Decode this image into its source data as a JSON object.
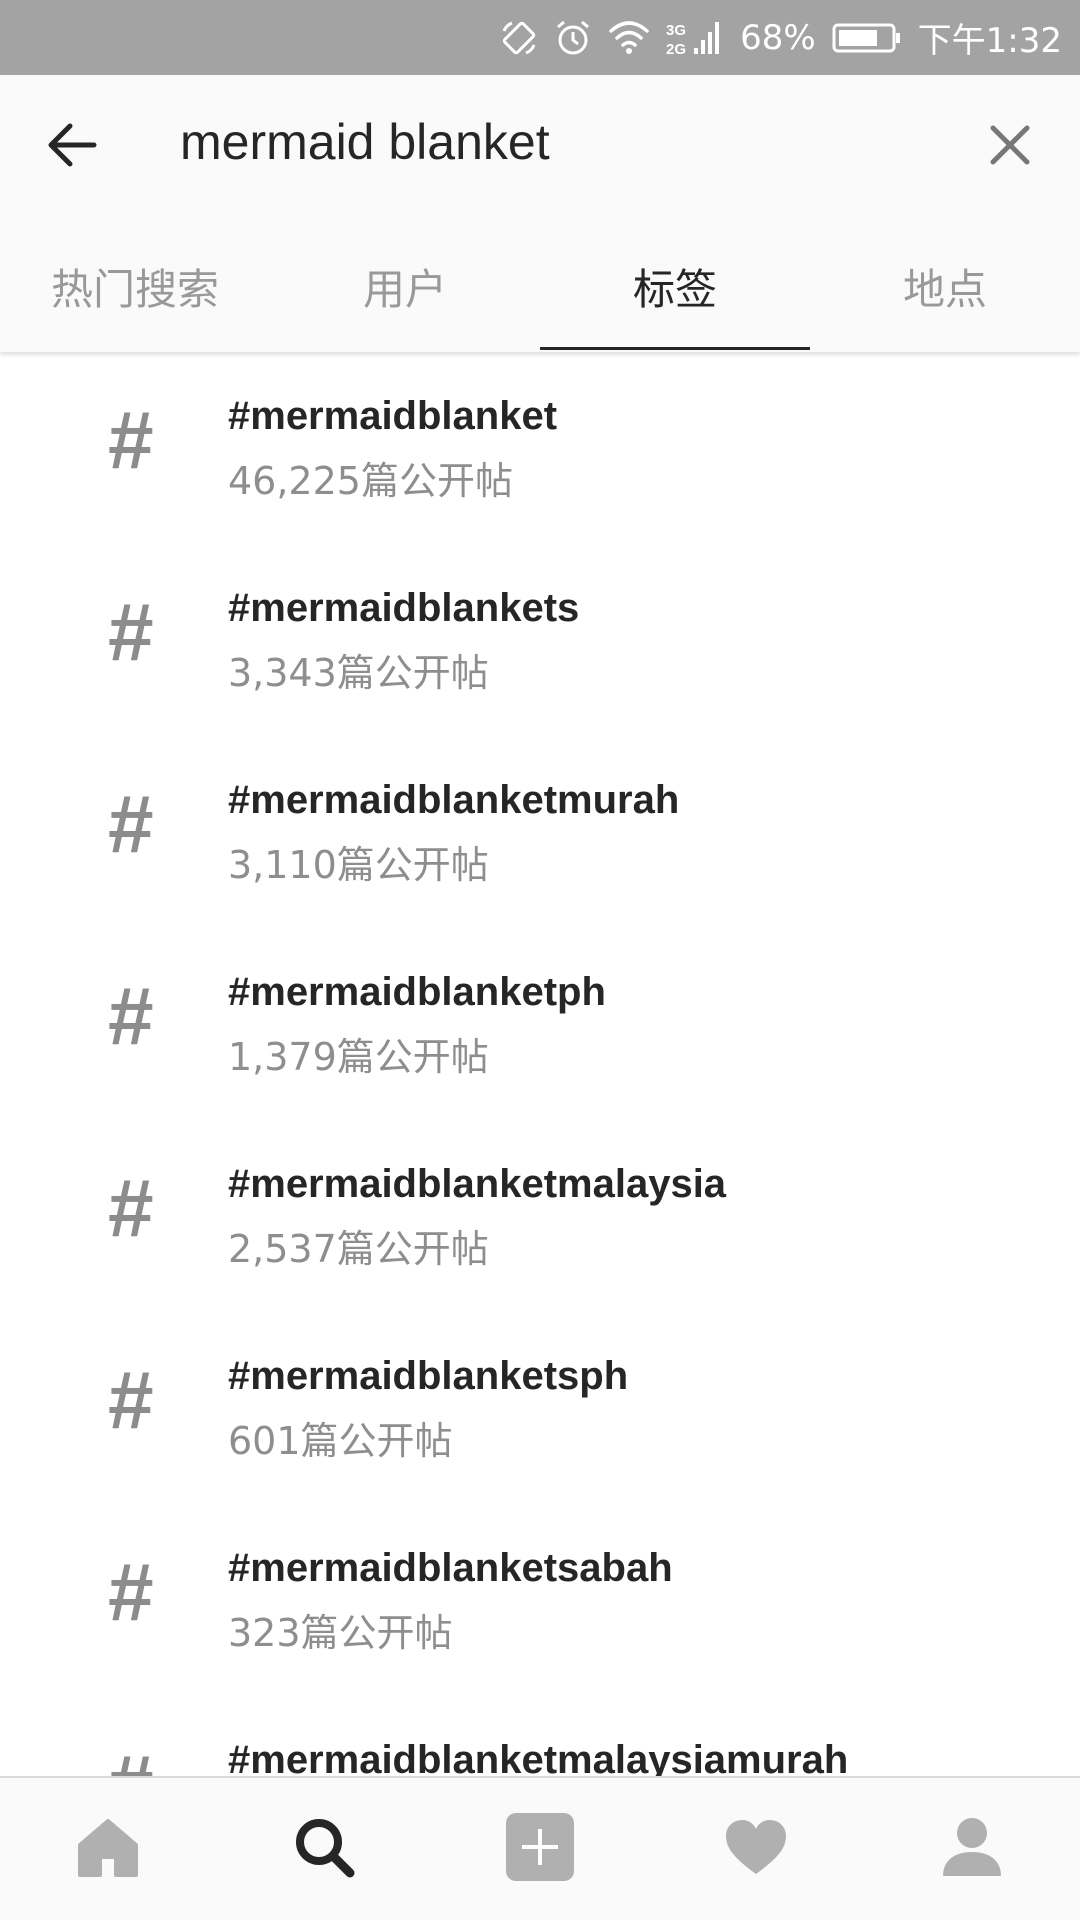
{
  "status_bar": {
    "network": "3G 2G",
    "battery_percent": "68%",
    "time": "下午1:32",
    "icons": [
      "rotate-icon",
      "alarm-icon",
      "wifi-icon",
      "signal-icon",
      "battery-icon"
    ]
  },
  "search": {
    "query": "mermaid blanket"
  },
  "tabs": [
    {
      "label": "热门搜索",
      "active": false
    },
    {
      "label": "用户",
      "active": false
    },
    {
      "label": "标签",
      "active": true
    },
    {
      "label": "地点",
      "active": false
    }
  ],
  "hashtags": [
    {
      "symbol": "#",
      "name": "#mermaidblanket",
      "count": "46,225篇公开帖"
    },
    {
      "symbol": "#",
      "name": "#mermaidblankets",
      "count": "3,343篇公开帖"
    },
    {
      "symbol": "#",
      "name": "#mermaidblanketmurah",
      "count": "3,110篇公开帖"
    },
    {
      "symbol": "#",
      "name": "#mermaidblanketph",
      "count": "1,379篇公开帖"
    },
    {
      "symbol": "#",
      "name": "#mermaidblanketmalaysia",
      "count": "2,537篇公开帖"
    },
    {
      "symbol": "#",
      "name": "#mermaidblanketsph",
      "count": "601篇公开帖"
    },
    {
      "symbol": "#",
      "name": "#mermaidblanketsabah",
      "count": "323篇公开帖"
    },
    {
      "symbol": "#",
      "name": "#mermaidblanketmalaysiamurah",
      "count": ""
    }
  ],
  "bottom_nav": [
    {
      "icon": "home-icon",
      "active": false
    },
    {
      "icon": "search-icon",
      "active": true
    },
    {
      "icon": "add-post-icon",
      "active": false
    },
    {
      "icon": "heart-icon",
      "active": false
    },
    {
      "icon": "profile-icon",
      "active": false
    }
  ],
  "colors": {
    "status_bar_bg": "#a3a3a3",
    "header_bg": "#fafafa",
    "text_primary": "#262626",
    "text_secondary": "#8e8e8e",
    "inactive_icon": "#b0b0b0"
  }
}
